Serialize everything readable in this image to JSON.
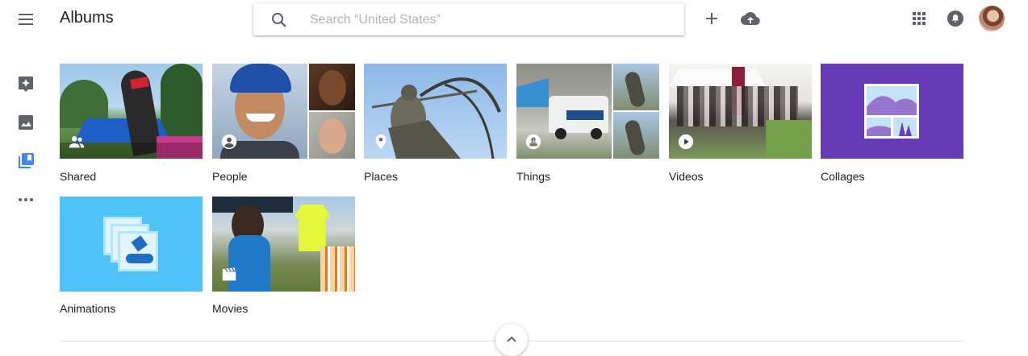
{
  "header": {
    "title": "Albums",
    "search_placeholder": "Search “United States”",
    "icons": [
      "menu-icon",
      "search-icon",
      "add-icon",
      "upload-icon",
      "apps-icon",
      "notifications-icon"
    ]
  },
  "sidebar": {
    "items": [
      {
        "icon": "assistant-icon"
      },
      {
        "icon": "photos-icon"
      },
      {
        "icon": "albums-icon",
        "active": true
      },
      {
        "icon": "more-icon"
      }
    ],
    "active_color": "#4285f4"
  },
  "albums": [
    {
      "label": "Shared",
      "badge": "people-icon"
    },
    {
      "label": "People",
      "badge": "person-icon"
    },
    {
      "label": "Places",
      "badge": "place-icon"
    },
    {
      "label": "Things",
      "badge": "things-icon"
    },
    {
      "label": "Videos",
      "badge": "play-icon"
    },
    {
      "label": "Collages",
      "badge": "collage-icon",
      "color": "#673ab7"
    },
    {
      "label": "Animations",
      "badge": "animation-icon",
      "color": "#4fc3f7"
    },
    {
      "label": "Movies",
      "badge": "movie-icon"
    }
  ],
  "footer": {
    "scroll_icon": "chevron-up-icon"
  }
}
